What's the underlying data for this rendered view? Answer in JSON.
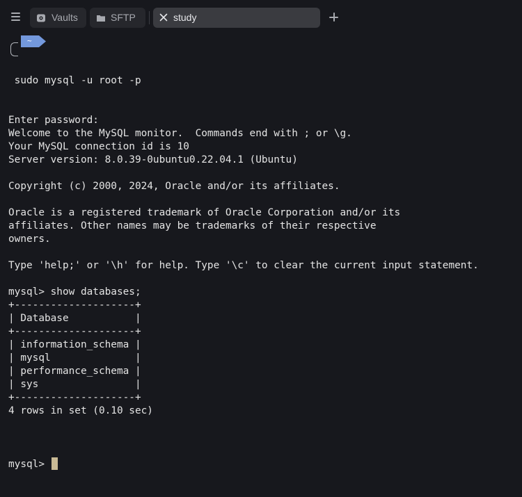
{
  "tabbar": {
    "menu_icon": "hamburger-menu-icon",
    "tabs": [
      {
        "label": "Vaults",
        "icon": "vault-icon",
        "active": false
      },
      {
        "label": "SFTP",
        "icon": "folder-icon",
        "active": false
      },
      {
        "label": "study",
        "icon": "close-icon",
        "active": true
      }
    ],
    "add_icon": "plus-icon"
  },
  "prompt": {
    "directory": "~",
    "command": " sudo mysql -u root -p"
  },
  "output_lines": [
    "Enter password:",
    "Welcome to the MySQL monitor.  Commands end with ; or \\g.",
    "Your MySQL connection id is 10",
    "Server version: 8.0.39-0ubuntu0.22.04.1 (Ubuntu)",
    "",
    "Copyright (c) 2000, 2024, Oracle and/or its affiliates.",
    "",
    "Oracle is a registered trademark of Oracle Corporation and/or its",
    "affiliates. Other names may be trademarks of their respective",
    "owners.",
    "",
    "Type 'help;' or '\\h' for help. Type '\\c' to clear the current input statement.",
    "",
    "mysql> show databases;",
    "+--------------------+",
    "| Database           |",
    "+--------------------+",
    "| information_schema |",
    "| mysql              |",
    "| performance_schema |",
    "| sys                |",
    "+--------------------+",
    "4 rows in set (0.10 sec)",
    ""
  ],
  "current_prompt": "mysql> ",
  "colors": {
    "background": "#17181d",
    "text": "#e4e4e4",
    "active_tab": "#3a3b40",
    "inactive_tab": "#26272c",
    "dir_badge": "#7398dc",
    "cursor": "#c9ba95"
  }
}
